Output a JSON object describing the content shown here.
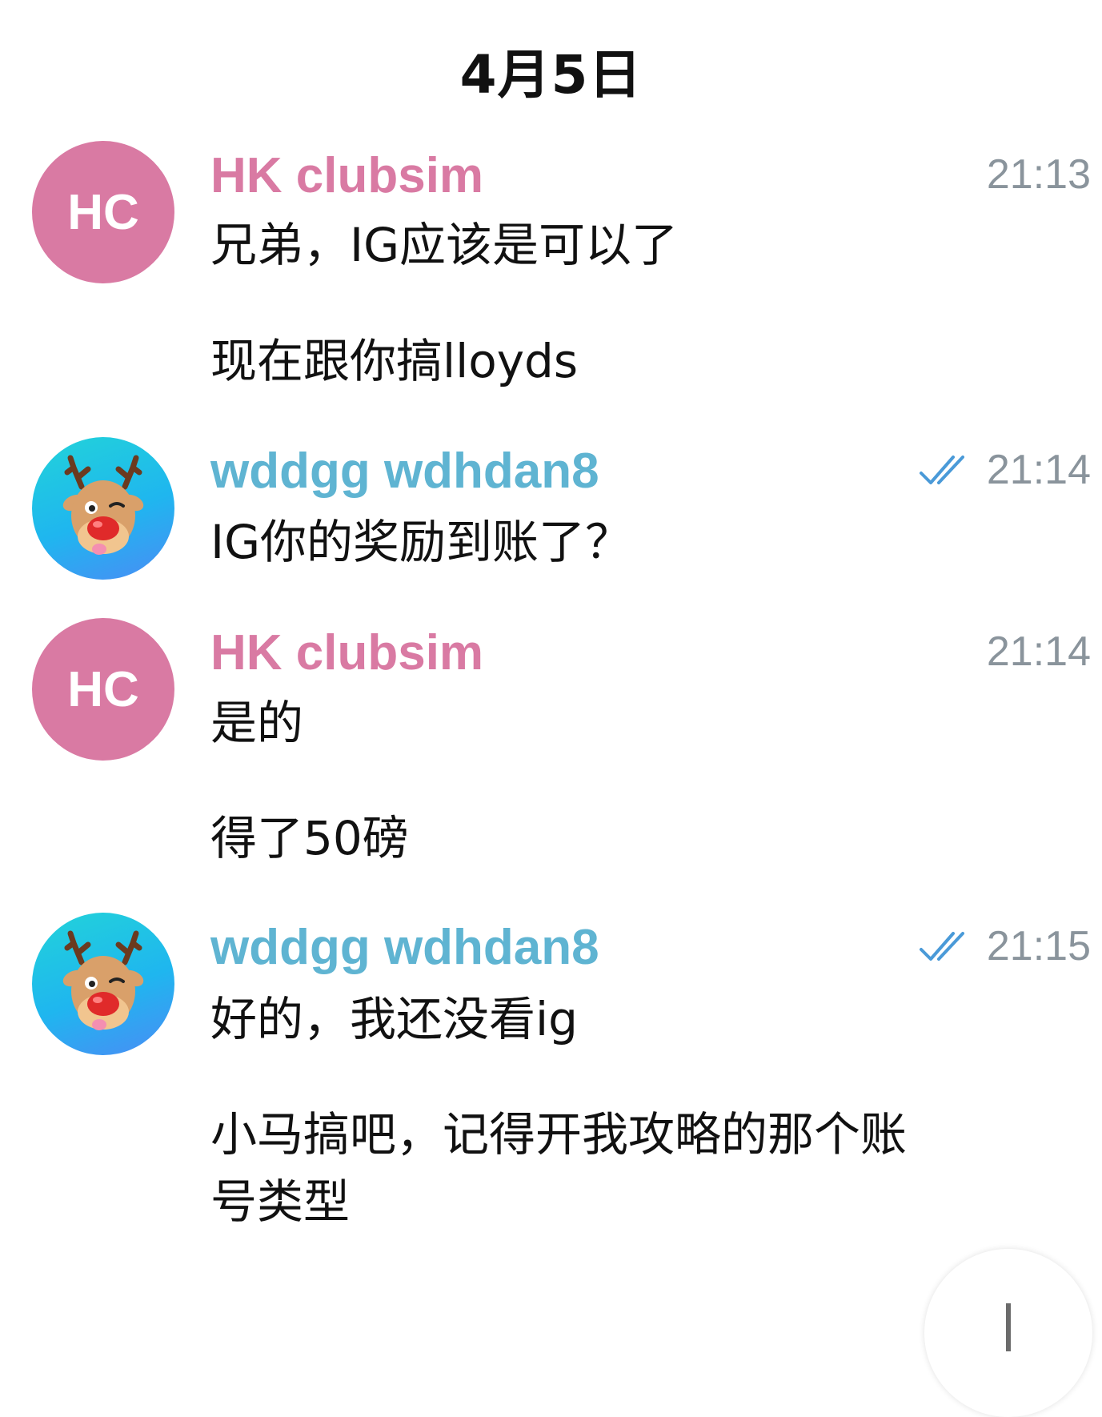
{
  "date_header": "4月5日",
  "messages": [
    {
      "avatar": {
        "type": "initials",
        "text": "HC",
        "color": "#d97aa3"
      },
      "sender": "HK clubsim",
      "time": "21:13",
      "read": false,
      "lines": [
        "兄弟，IG应该是可以了",
        "现在跟你搞lloyds"
      ]
    },
    {
      "avatar": {
        "type": "icon",
        "icon": "reindeer-avatar-icon"
      },
      "sender": "wddgg wdhdan8",
      "time": "21:14",
      "read": true,
      "lines": [
        "IG你的奖励到账了？"
      ]
    },
    {
      "avatar": {
        "type": "initials",
        "text": "HC",
        "color": "#d97aa3"
      },
      "sender": "HK clubsim",
      "time": "21:14",
      "read": false,
      "lines": [
        "是的",
        "得了50磅"
      ]
    },
    {
      "avatar": {
        "type": "icon",
        "icon": "reindeer-avatar-icon"
      },
      "sender": "wddgg wdhdan8",
      "time": "21:15",
      "read": true,
      "lines": [
        "好的，我还没看ig",
        "小马搞吧，记得开我攻略的那个账",
        "号类型"
      ]
    }
  ],
  "colors": {
    "pink_sender": "#d97aa3",
    "teal_sender": "#5fb4d2",
    "time_gray": "#8a949c",
    "check_blue": "#4a9ad8"
  }
}
